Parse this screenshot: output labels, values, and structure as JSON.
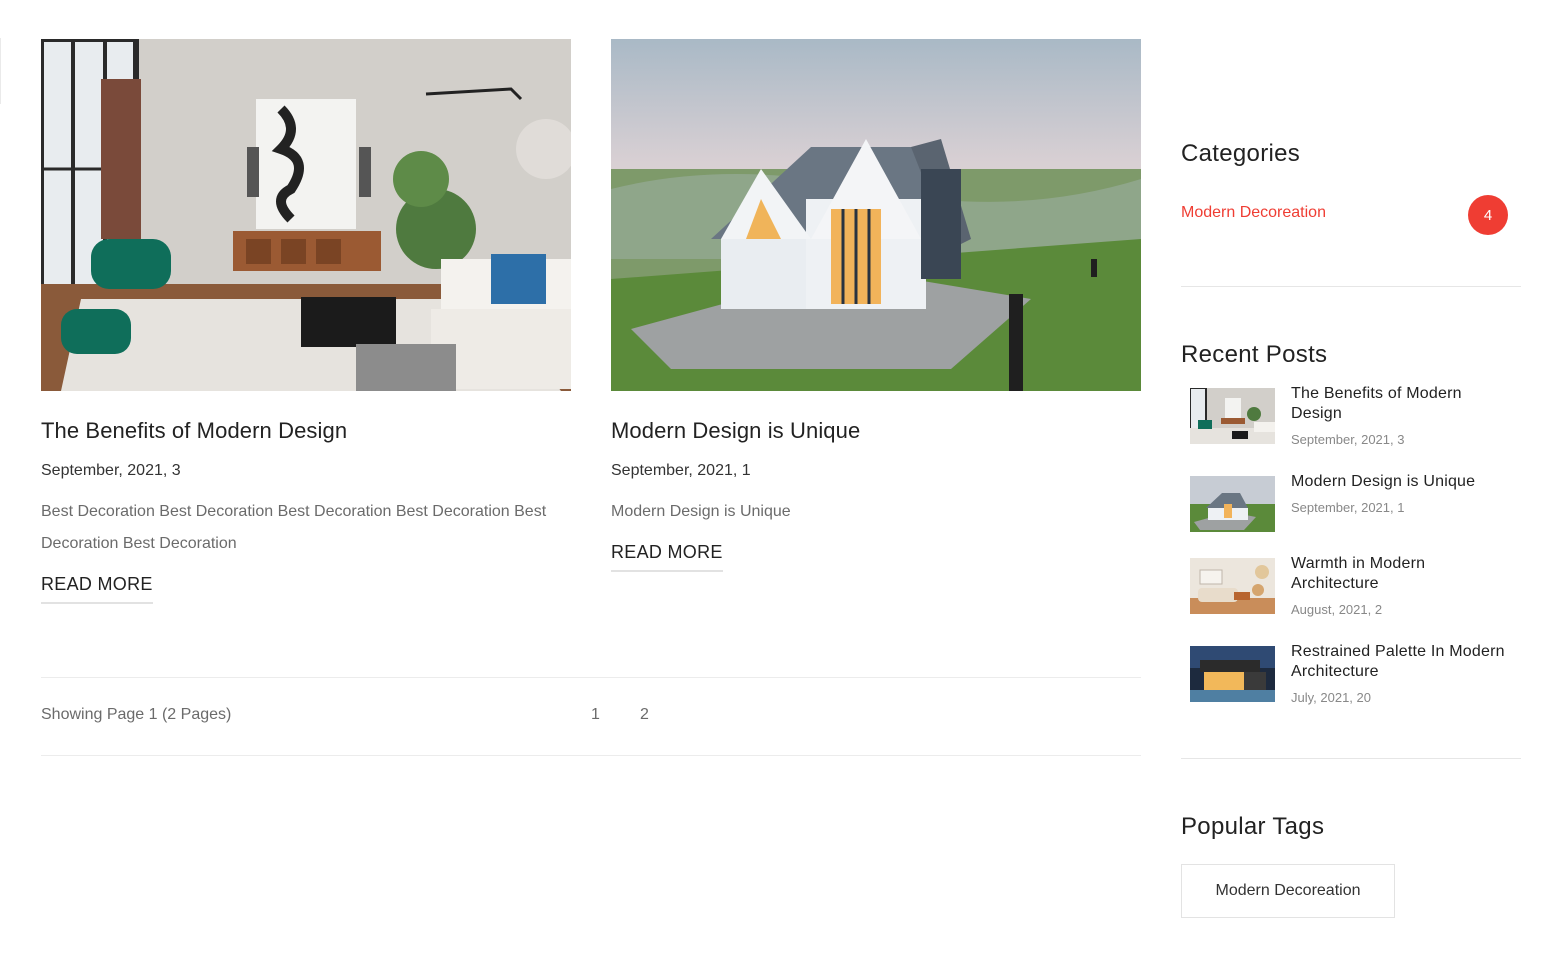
{
  "colors": {
    "accent": "#ef3d33",
    "text": "#222222",
    "muted": "#6b6b6b",
    "border": "#e6e6e6"
  },
  "posts": [
    {
      "title": "The Benefits of Modern Design",
      "date": "September, 2021, 3",
      "excerpt": "Best Decoration Best Decoration Best Decoration Best Decoration Best Decoration Best Decoration",
      "read_more": "READ MORE",
      "image": "living-room-photo"
    },
    {
      "title": "Modern Design is Unique",
      "date": "September, 2021, 1",
      "excerpt": "Modern Design is Unique",
      "read_more": "READ MORE",
      "image": "house-at-dusk-photo"
    }
  ],
  "pagination": {
    "info": "Showing Page 1 (2 Pages)",
    "pages": [
      "1",
      "2"
    ]
  },
  "sidebar": {
    "categories": {
      "title": "Categories",
      "items": [
        {
          "name": "Modern Decoreation",
          "count": "4"
        }
      ]
    },
    "recent_posts": {
      "title": "Recent Posts",
      "items": [
        {
          "title": "The Benefits of Modern Design",
          "date": "September, 2021, 3"
        },
        {
          "title": "Modern Design is Unique",
          "date": "September, 2021, 1"
        },
        {
          "title": "Warmth in Modern Architecture",
          "date": "August, 2021, 2"
        },
        {
          "title": "Restrained Palette In Modern Architecture",
          "date": "July, 2021, 20"
        }
      ]
    },
    "popular_tags": {
      "title": "Popular Tags",
      "tags": [
        "Modern Decoreation"
      ]
    }
  }
}
